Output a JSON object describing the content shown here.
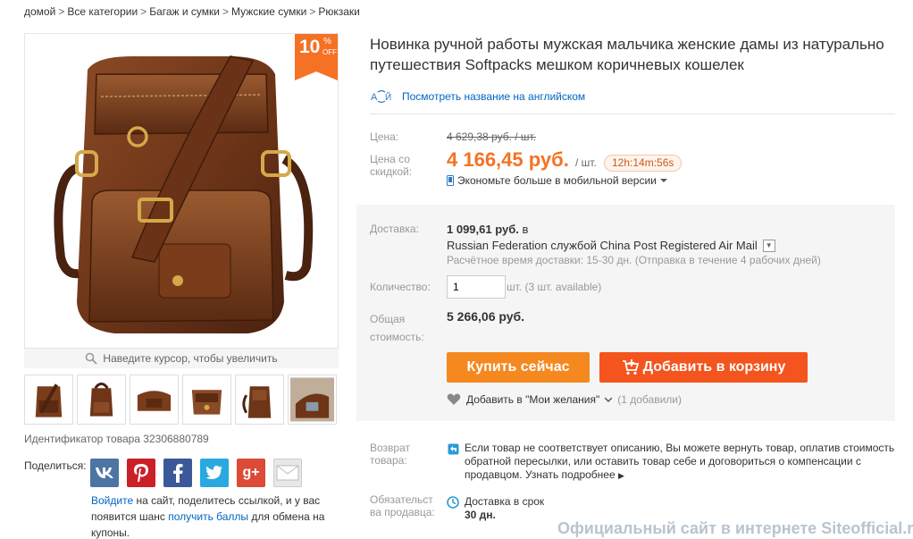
{
  "breadcrumb": {
    "items": [
      "домой",
      "Все категории",
      "Багаж и сумки",
      "Мужские сумки",
      "Рюкзаки"
    ],
    "separator": ">"
  },
  "badge": {
    "value": "10",
    "percent": "%",
    "off": "OFF"
  },
  "gallery": {
    "zoom_hint": "Наведите курсор, чтобы увеличить",
    "thumbnail_count": 6
  },
  "product": {
    "id_text": "Идентификатор товара 32306880789",
    "title_line1": "Новинка ручной работы мужская мальчика женские дамы из натурально",
    "title_line2": "путешествия Softpacks мешком коричневых кошелек",
    "translate_link": "Посмотреть название на английском"
  },
  "pricing": {
    "price_label": "Цена:",
    "old_price": "4 629,38 руб. / шт.",
    "discount_label_line1": "Цена со",
    "discount_label_line2": "скидкой:",
    "new_price": "4 166,45 руб.",
    "unit": "/ шт.",
    "timer": "12h:14m:56s",
    "mobile_text": "Экономьте больше в мобильной версии"
  },
  "shipping": {
    "label": "Доставка:",
    "price": "1 099,61 руб.",
    "price_suffix": "в",
    "method": "Russian Federation службой China Post Registered Air Mail",
    "time": "Расчётное время доставки: 15-30 дн. (Отправка в течение 4 рабочих дней)"
  },
  "quantity": {
    "label": "Количество:",
    "value": "1",
    "note": "шт. (3 шт. available)"
  },
  "total": {
    "label_line1": "Общая",
    "label_line2": "стоимость:",
    "value": "5 266,06 руб."
  },
  "actions": {
    "buy": "Купить сейчас",
    "cart": "Добавить в корзину",
    "wishlist": "Добавить в \"Мои желания\"",
    "wishlist_count": "(1 добавили)"
  },
  "returns": {
    "label_line1": "Возврат",
    "label_line2": "товара:",
    "line1": "Если товар не соответствует описанию, Вы можете вернуть товар, оплатив стоимость",
    "line2": "обратной пересылки, или оставить товар себе и договориться о компенсации с",
    "line3": "продавцом. Узнать подробнее"
  },
  "seller": {
    "label_line1": "Обязательст",
    "label_line2": "ва продавца:",
    "line1": "Доставка в срок",
    "line2": "30 дн."
  },
  "share": {
    "label": "Поделиться:",
    "networks": [
      "vk",
      "pinterest",
      "facebook",
      "twitter",
      "google-plus",
      "email"
    ],
    "text_login": "Войдите",
    "text_1": " на сайт, поделитесь ссылкой, и у вас",
    "text_2": "появится шанс ",
    "text_link": "получить баллы",
    "text_3": " для обмена на",
    "text_4": "купоны."
  },
  "watermark": "Официальный сайт в интернете Siteofficial.ru",
  "colors": {
    "accent_orange": "#f57224",
    "buy_button": "#f5881f",
    "cart_button": "#f4541d",
    "link": "#0066c0"
  }
}
